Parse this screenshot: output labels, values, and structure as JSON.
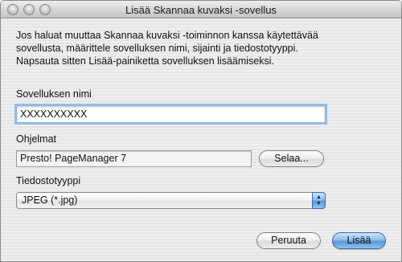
{
  "window": {
    "title": "Lisää Skannaa kuvaksi -sovellus"
  },
  "description": {
    "line1": "Jos haluat muuttaa Skannaa kuvaksi -toiminnon kanssa käytettävää",
    "line2": "sovellusta, määrittele sovelluksen nimi, sijainti ja tiedostotyyppi.",
    "line3": "Napsauta sitten Lisää-painiketta sovelluksen lisäämiseksi."
  },
  "app_name": {
    "label": "Sovelluksen nimi",
    "value": "XXXXXXXXXX"
  },
  "programs": {
    "label": "Ohjelmat",
    "value": "Presto! PageManager 7",
    "browse_label": "Selaa..."
  },
  "file_type": {
    "label": "Tiedostotyyppi",
    "selected": "JPEG (*.jpg)"
  },
  "buttons": {
    "cancel_label": "Peruuta",
    "add_label": "Lisää"
  },
  "icons": {
    "close": "close-window-icon",
    "minimize": "minimize-window-icon",
    "zoom": "zoom-window-icon",
    "select_arrows": "up-down-arrows-icon"
  }
}
